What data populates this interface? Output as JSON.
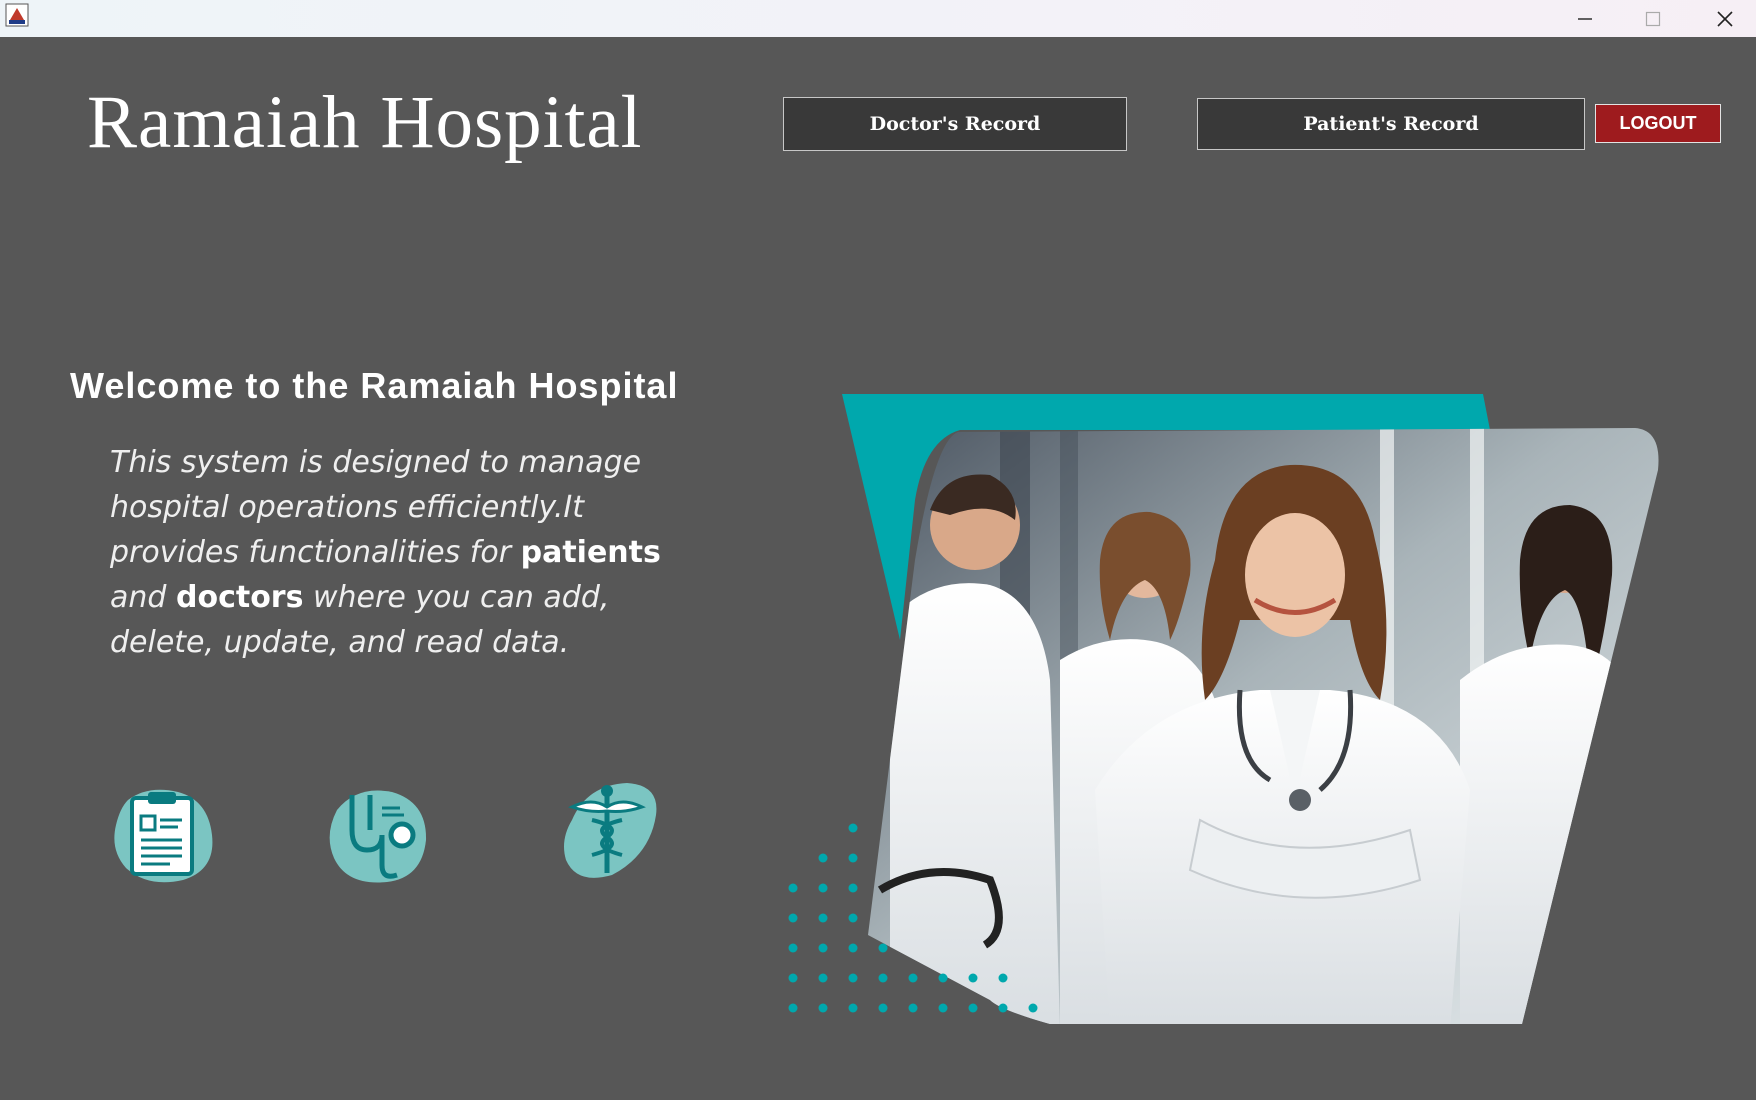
{
  "window": {
    "app_icon": "java-coffee-icon",
    "controls": [
      "minimize-icon",
      "maximize-icon",
      "close-icon"
    ]
  },
  "header": {
    "brand": "Ramaiah Hospital",
    "doctor_button": "Doctor's Record",
    "patient_button": "Patient's Record",
    "logout_button": "LOGOUT"
  },
  "main": {
    "welcome": "Welcome to the Ramaiah Hospital",
    "description": {
      "part1": "This system is designed to manage hospital operations efficiently.It provides functionalities for ",
      "bold1": "patients",
      "part2": " and ",
      "bold2": "doctors",
      "part3": " where you can add, delete, update, and read data."
    },
    "features": [
      "clipboard-icon",
      "stethoscope-icon",
      "caduceus-icon"
    ]
  },
  "colors": {
    "background": "#575757",
    "accent_teal": "#00a8ad",
    "logout_red": "#9e1b1e",
    "nav_button": "#393939"
  }
}
